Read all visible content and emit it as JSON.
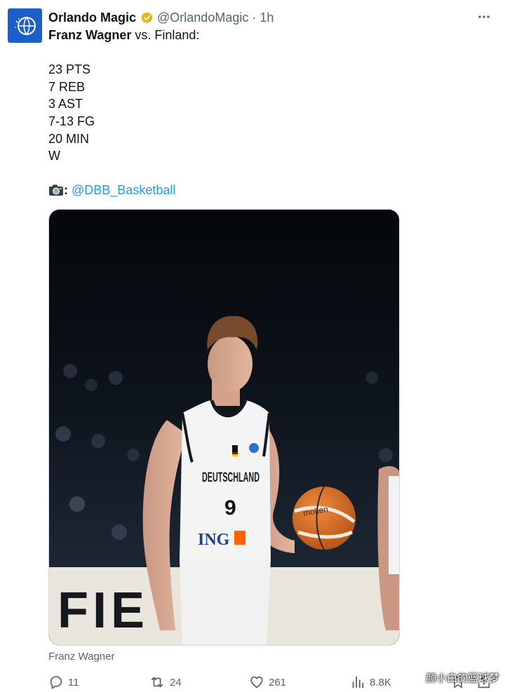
{
  "tweet": {
    "author_name": "Orlando Magic",
    "handle": "@OrlandoMagic",
    "separator": "·",
    "time": "1h",
    "player_name": "Franz Wagner",
    "headline_rest": " vs. Finland:",
    "stats": [
      "23 PTS",
      "7 REB",
      "3 AST",
      "7-13 FG",
      "20 MIN",
      "W"
    ],
    "credit_sep": ":",
    "credit_link": "@DBB_Basketball",
    "image_caption": "Franz Wagner"
  },
  "photo": {
    "jersey_text": "DEUTSCHLAND",
    "jersey_number": "9",
    "sponsor": "ING",
    "ball_brand": "molten",
    "signage": "FIE"
  },
  "actions": {
    "replies": "11",
    "reposts": "24",
    "likes": "261",
    "views": "8.8K"
  },
  "watermark": "颜小白的篮球梦",
  "colors": {
    "link": "#1d9bf0",
    "secondary_text": "#536471",
    "verified": "#e2b719",
    "avatar_bg": "#1d5fc9"
  },
  "icons": [
    "magic-logo-icon",
    "verified-badge-icon",
    "more-icon",
    "camera-icon",
    "reply-icon",
    "repost-icon",
    "like-icon",
    "views-icon",
    "bookmark-icon",
    "share-icon"
  ]
}
